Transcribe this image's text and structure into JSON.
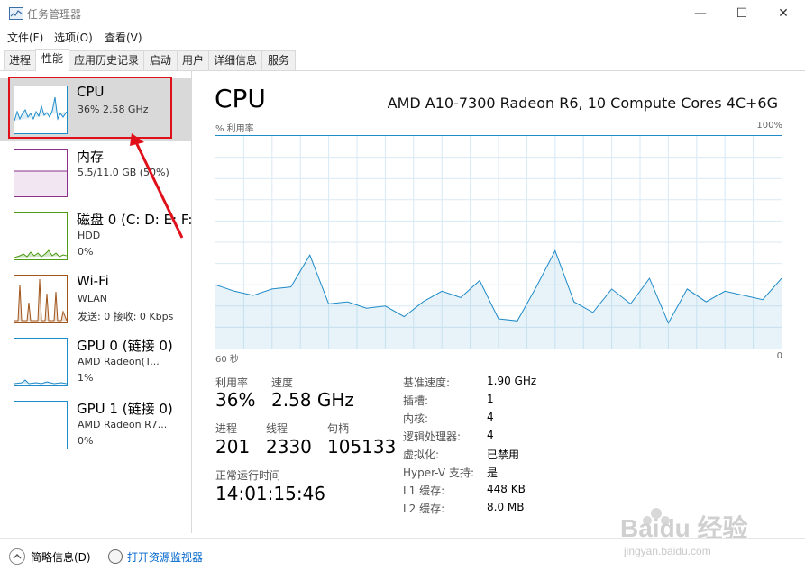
{
  "window": {
    "title": "任务管理器",
    "minimize_glyph": "—",
    "maximize_glyph": "☐",
    "close_glyph": "✕"
  },
  "menu": [
    "文件(F)",
    "选项(O)",
    "查看(V)"
  ],
  "tabs": [
    "进程",
    "性能",
    "应用历史记录",
    "启动",
    "用户",
    "详细信息",
    "服务"
  ],
  "sidebar": {
    "items": [
      {
        "name": "CPU",
        "line1": "36%  2.58 GHz",
        "line2": "",
        "selected": true
      },
      {
        "name": "内存",
        "line1": "5.5/11.0 GB (50%)",
        "line2": ""
      },
      {
        "name": "磁盘 0 (C: D: E: F:",
        "line1": "HDD",
        "line2": "0%"
      },
      {
        "name": "Wi-Fi",
        "line1": "WLAN",
        "line2": "发送: 0  接收: 0 Kbps"
      },
      {
        "name": "GPU 0 (链接 0)",
        "line1": "AMD Radeon(T...",
        "line2": "1%"
      },
      {
        "name": "GPU 1 (链接 0)",
        "line1": "AMD Radeon R7...",
        "line2": "0%"
      }
    ]
  },
  "main": {
    "title": "CPU",
    "model": "AMD A10-7300 Radeon R6, 10 Compute Cores 4C+6G",
    "graph": {
      "ylabel": "% 利用率",
      "ymax_label": "100%",
      "xleft_label": "60 秒",
      "xright_label": "0"
    },
    "stats": {
      "util_label": "利用率",
      "util_value": "36%",
      "speed_label": "速度",
      "speed_value": "2.58 GHz",
      "proc_label": "进程",
      "proc_value": "201",
      "thread_label": "线程",
      "thread_value": "2330",
      "handle_label": "句柄",
      "handle_value": "105133",
      "uptime_label": "正常运行时间",
      "uptime_value": "14:01:15:46"
    },
    "details": [
      {
        "label": "基准速度:",
        "value": "1.90 GHz"
      },
      {
        "label": "插槽:",
        "value": "1"
      },
      {
        "label": "内核:",
        "value": "4"
      },
      {
        "label": "逻辑处理器:",
        "value": "4"
      },
      {
        "label": "虚拟化:",
        "value": "已禁用"
      },
      {
        "label": "Hyper-V 支持:",
        "value": "是"
      },
      {
        "label": "L1 缓存:",
        "value": "448 KB"
      },
      {
        "label": "L2 缓存:",
        "value": "8.0 MB"
      }
    ]
  },
  "footer": {
    "less_details": "简略信息(D)",
    "resource_monitor": "打开资源监视器"
  },
  "watermark": {
    "brand": "Baidu 经验",
    "url": "jingyan.baidu.com"
  },
  "colors": {
    "accent": "#1f8bc8",
    "highlight": "#e0101a",
    "memory": "#8b2f8b",
    "disk": "#4c9a16",
    "wifi": "#a0541a"
  },
  "chart_data": {
    "type": "area",
    "x": [
      60,
      58,
      56,
      54,
      52,
      50,
      48,
      46,
      44,
      42,
      40,
      38,
      36,
      34,
      32,
      30,
      28,
      26,
      24,
      22,
      20,
      18,
      16,
      14,
      12,
      10,
      8,
      6,
      4,
      2,
      0
    ],
    "values": [
      30,
      27,
      25,
      28,
      29,
      44,
      21,
      22,
      19,
      20,
      15,
      22,
      27,
      24,
      32,
      14,
      13,
      29,
      46,
      22,
      17,
      28,
      21,
      33,
      12,
      28,
      22,
      27,
      25,
      23,
      33
    ],
    "ylim": [
      0,
      100
    ],
    "xlim": [
      60,
      0
    ]
  }
}
